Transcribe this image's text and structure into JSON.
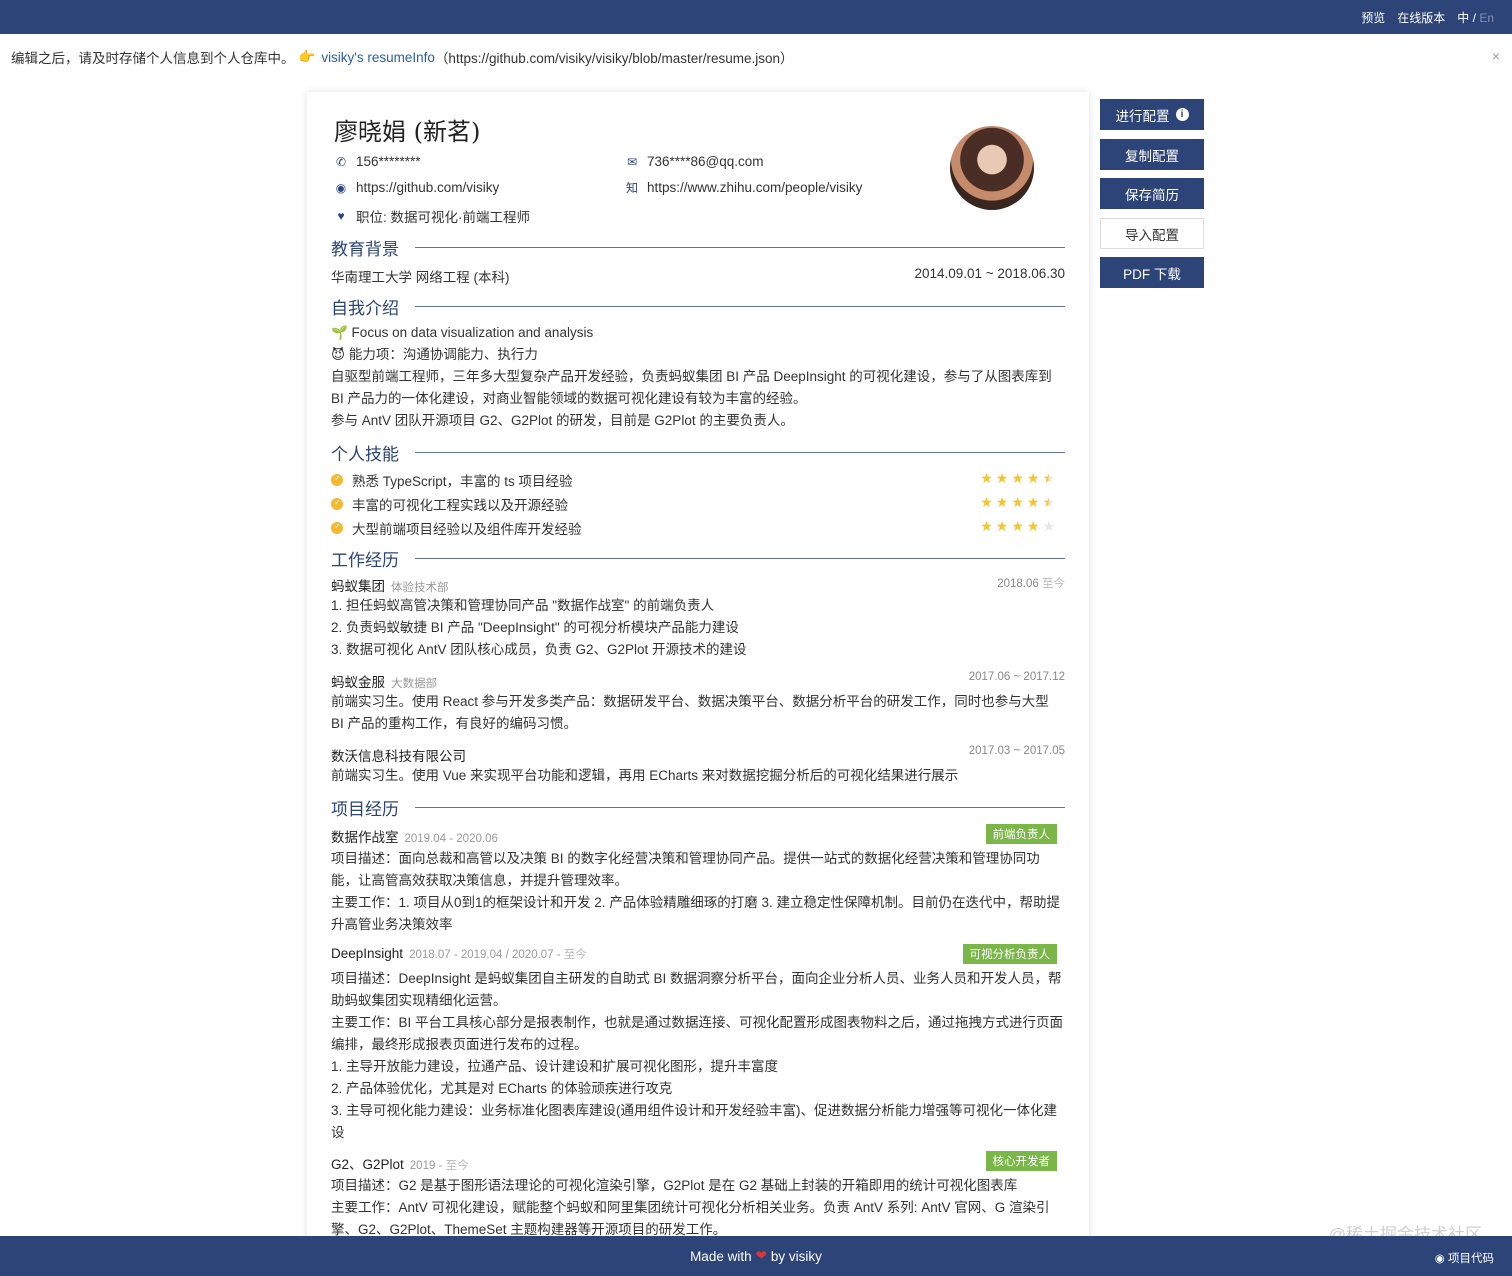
{
  "topbar": {
    "preview": "预览",
    "online": "在线版本",
    "lang_zh": "中",
    "lang_sep": " / ",
    "lang_en": "En"
  },
  "notice": {
    "text": "编辑之后，请及时存储个人信息到个人仓库中。",
    "hand": "👉",
    "link": "visiky's resumeInfo",
    "url": "（https://github.com/visiky/visiky/blob/master/resume.json）",
    "close": "×"
  },
  "profile": {
    "name": "廖晓娟 (新茗)",
    "phone": "156********",
    "email": "736****86@qq.com",
    "github": "https://github.com/visiky",
    "zhihu": "https://www.zhihu.com/people/visiky",
    "position": "职位: 数据可视化·前端工程师"
  },
  "education": {
    "title": "教育背景",
    "school": "华南理工大学  网络工程 (本科)",
    "date": "2014.09.01 ~ 2018.06.30"
  },
  "about": {
    "title": "自我介绍",
    "l1": "🌱 Focus on data visualization and analysis",
    "l2": "😈 能力项：沟通协调能力、执行力",
    "l3": "自驱型前端工程师，三年多大型复杂产品开发经验，负责蚂蚁集团 BI 产品 DeepInsight 的可视化建设，参与了从图表库到 BI 产品力的一体化建设，对商业智能领域的数据可视化建设有较为丰富的经验。",
    "l4": "参与 AntV 团队开源项目 G2、G2Plot 的研发，目前是 G2Plot 的主要负责人。"
  },
  "skills": {
    "title": "个人技能",
    "items": [
      {
        "label": "熟悉 TypeScript，丰富的 ts 项目经验",
        "rating": 4.5
      },
      {
        "label": "丰富的可视化工程实践以及开源经验",
        "rating": 4.5
      },
      {
        "label": "大型前端项目经验以及组件库开发经验",
        "rating": 4
      }
    ]
  },
  "work": {
    "title": "工作经历",
    "items": [
      {
        "company": "蚂蚁集团",
        "dept": "体验技术部",
        "date": "2018.06",
        "date_sub": " 至今",
        "lines": [
          "1. 担任蚂蚁高管决策和管理协同产品 \"数据作战室\" 的前端负责人",
          "2. 负责蚂蚁敏捷 BI 产品 \"DeepInsight\" 的可视分析模块产品能力建设",
          "3. 数据可视化 AntV 团队核心成员，负责 G2、G2Plot 开源技术的建设"
        ]
      },
      {
        "company": "蚂蚁金服",
        "dept": "大数据部",
        "date": "2017.06 ~ 2017.12",
        "desc": "前端实习生。使用 React 参与开发多类产品：数据研发平台、数据决策平台、数据分析平台的研发工作，同时也参与大型 BI 产品的重构工作，有良好的编码习惯。"
      },
      {
        "company": "数沃信息科技有限公司",
        "dept": "",
        "date": "2017.03 ~ 2017.05",
        "desc": "前端实习生。使用 Vue 来实现平台功能和逻辑，再用 ECharts 来对数据挖掘分析后的可视化结果进行展示"
      }
    ]
  },
  "projects": {
    "title": "项目经历",
    "items": [
      {
        "name": "数据作战室",
        "date": "2019.04 - 2020.06",
        "role": "前端负责人",
        "desc": "项目描述：面向总裁和高管以及决策 BI 的数字化经营决策和管理协同产品。提供一站式的数据化经营决策和管理协同功能，让高管高效获取决策信息，并提升管理效率。",
        "work": "主要工作：1. 项目从0到1的框架设计和开发 2. 产品体验精雕细琢的打磨 3. 建立稳定性保障机制。目前仍在迭代中，帮助提升高管业务决策效率"
      },
      {
        "name": "DeepInsight",
        "date": "2018.07 - 2019.04 / 2020.07 - ",
        "date_sub": "至今",
        "role": "可视分析负责人",
        "desc": "项目描述：DeepInsight 是蚂蚁集团自主研发的自助式 BI 数据洞察分析平台，面向企业分析人员、业务人员和开发人员，帮助蚂蚁集团实现精细化运营。",
        "work": "主要工作：BI 平台工具核心部分是报表制作，也就是通过数据连接、可视化配置形成图表物料之后，通过拖拽方式进行页面编排，最终形成报表页面进行发布的过程。",
        "p1": "1. 主导开放能力建设，拉通产品、设计建设和扩展可视化图形，提升丰富度",
        "p2": "2. 产品体验优化，尤其是对 ECharts 的体验顽疾进行攻克",
        "p3": "3. 主导可视化能力建设：业务标准化图表库建设(通用组件设计和开发经验丰富)、促进数据分析能力增强等可视化一体化建设"
      },
      {
        "name": "G2、G2Plot",
        "date": "2019 - ",
        "date_sub": "至今",
        "role": "核心开发者",
        "desc": "项目描述：G2 是基于图形语法理论的可视化渲染引擎，G2Plot 是在 G2 基础上封装的开箱即用的统计可视化图表库",
        "work": "主要工作：AntV 可视化建设，赋能整个蚂蚁和阿里集团统计可视化分析相关业务。负责 AntV 系列: AntV 官网、G 渲染引擎、G2、G2Plot、ThemeSet 主题构建器等开源项目的研发工作。"
      }
    ]
  },
  "actions": {
    "config": "进行配置",
    "info": "i",
    "copy": "复制配置",
    "save": "保存简历",
    "import": "导入配置",
    "pdf": "PDF 下载"
  },
  "footer": {
    "made": "Made with",
    "heart": "❤",
    "by": "by visiky",
    "code": "项目代码",
    "watermark": "@稀土掘金技术社区"
  },
  "colors": {
    "primary": "#2c4478",
    "tag": "#7ab648",
    "star": "#f7c52a"
  }
}
